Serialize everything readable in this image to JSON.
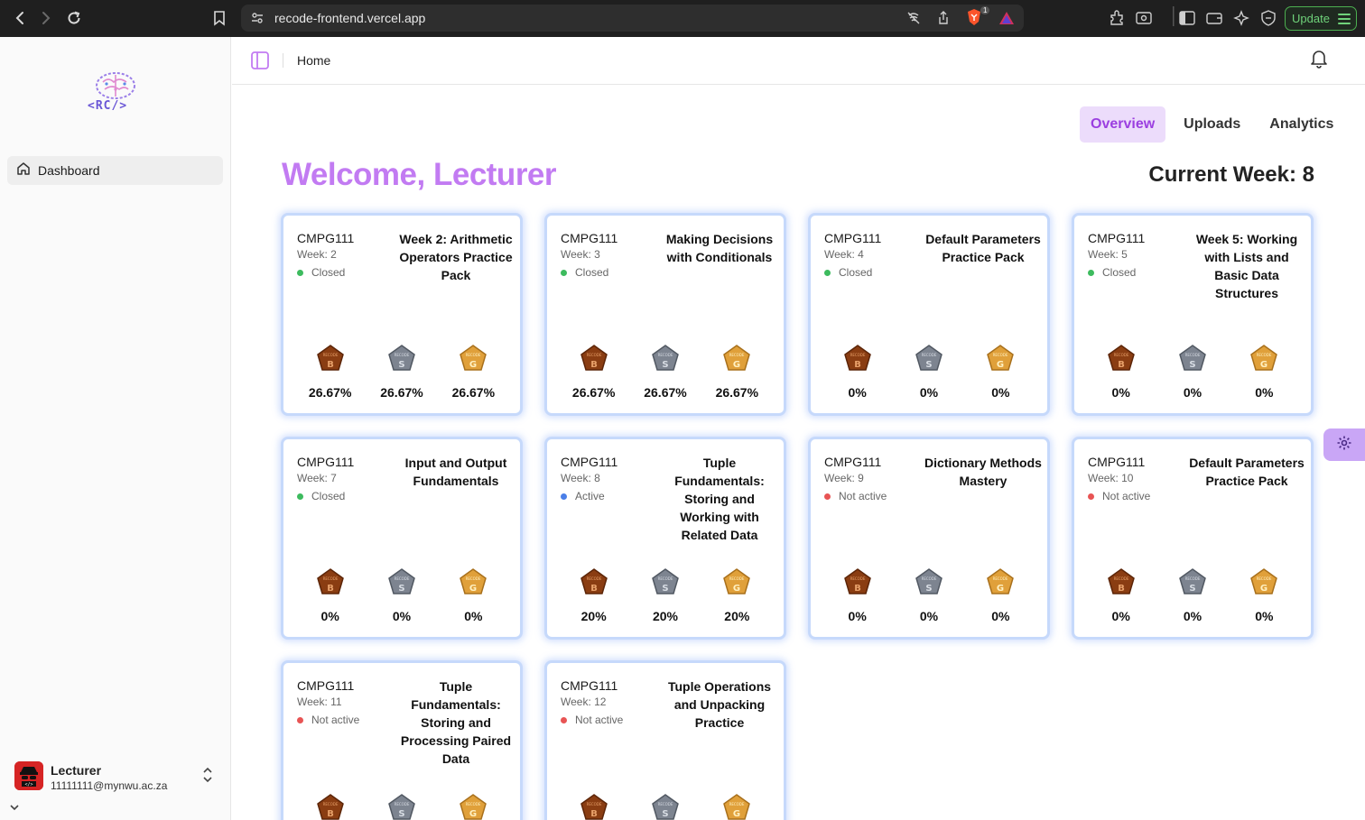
{
  "browser": {
    "url": "recode-frontend.vercel.app",
    "update_label": "Update",
    "brave_count": "1"
  },
  "sidebar": {
    "logo_text": "<RC/>",
    "nav": [
      {
        "label": "Dashboard",
        "icon": "home-icon"
      }
    ],
    "user": {
      "name": "Lecturer",
      "email": "11111111@mynwu.ac.za"
    }
  },
  "header": {
    "breadcrumb": "Home"
  },
  "tabs": [
    {
      "label": "Overview",
      "active": true
    },
    {
      "label": "Uploads",
      "active": false
    },
    {
      "label": "Analytics",
      "active": false
    }
  ],
  "main": {
    "welcome": "Welcome, Lecturer",
    "current_week": "Current Week: 8"
  },
  "badge_labels": {
    "bronze": "B",
    "silver": "S",
    "gold": "G"
  },
  "colors": {
    "accent": "#c27bf2",
    "closed": "#3dbb5e",
    "active": "#4a7fe8",
    "not_active": "#e85454"
  },
  "cards": [
    {
      "code": "CMPG111",
      "week": "Week: 2",
      "status": "Closed",
      "status_kind": "closed",
      "title": "Week 2: Arithmetic Operators Practice Pack",
      "bronze": "26.67%",
      "silver": "26.67%",
      "gold": "26.67%"
    },
    {
      "code": "CMPG111",
      "week": "Week: 3",
      "status": "Closed",
      "status_kind": "closed",
      "title": "Making Decisions with Conditionals",
      "bronze": "26.67%",
      "silver": "26.67%",
      "gold": "26.67%"
    },
    {
      "code": "CMPG111",
      "week": "Week: 4",
      "status": "Closed",
      "status_kind": "closed",
      "title": "Default Parameters Practice Pack",
      "bronze": "0%",
      "silver": "0%",
      "gold": "0%"
    },
    {
      "code": "CMPG111",
      "week": "Week: 5",
      "status": "Closed",
      "status_kind": "closed",
      "title": "Week 5: Working with Lists and Basic Data Structures",
      "bronze": "0%",
      "silver": "0%",
      "gold": "0%"
    },
    {
      "code": "CMPG111",
      "week": "Week: 7",
      "status": "Closed",
      "status_kind": "closed",
      "title": "Input and Output Fundamentals",
      "bronze": "0%",
      "silver": "0%",
      "gold": "0%"
    },
    {
      "code": "CMPG111",
      "week": "Week: 8",
      "status": "Active",
      "status_kind": "active",
      "title": "Tuple Fundamentals: Storing and Working with Related Data",
      "bronze": "20%",
      "silver": "20%",
      "gold": "20%"
    },
    {
      "code": "CMPG111",
      "week": "Week: 9",
      "status": "Not active",
      "status_kind": "not_active",
      "title": "Dictionary Methods Mastery",
      "bronze": "0%",
      "silver": "0%",
      "gold": "0%"
    },
    {
      "code": "CMPG111",
      "week": "Week: 10",
      "status": "Not active",
      "status_kind": "not_active",
      "title": "Default Parameters Practice Pack",
      "bronze": "0%",
      "silver": "0%",
      "gold": "0%"
    },
    {
      "code": "CMPG111",
      "week": "Week: 11",
      "status": "Not active",
      "status_kind": "not_active",
      "title": "Tuple Fundamentals: Storing and Processing Paired Data",
      "bronze": "",
      "silver": "",
      "gold": ""
    },
    {
      "code": "CMPG111",
      "week": "Week: 12",
      "status": "Not active",
      "status_kind": "not_active",
      "title": "Tuple Operations and Unpacking Practice",
      "bronze": "",
      "silver": "",
      "gold": ""
    }
  ]
}
